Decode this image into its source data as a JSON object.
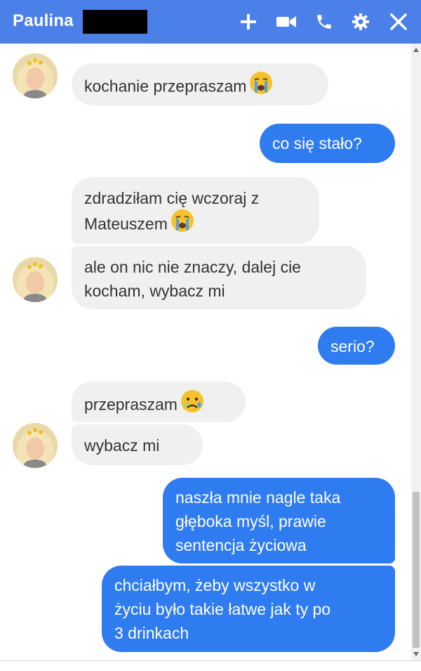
{
  "header": {
    "title": "Paulina",
    "redacted": true,
    "background_color": "#4a80e8",
    "icons": [
      "plus-icon",
      "video-camera-icon",
      "phone-icon",
      "gear-icon",
      "close-icon"
    ]
  },
  "messages": [
    {
      "from": "contact",
      "text": "kochanie przepraszam",
      "emoji": "crying-face"
    },
    {
      "from": "me",
      "text": "co się stało?"
    },
    {
      "from": "contact",
      "lines": [
        "zdradziłam cię wczoraj z",
        "Mateuszem"
      ],
      "emoji": "crying-face"
    },
    {
      "from": "contact",
      "lines": [
        "ale on nic nie znaczy, dalej cie",
        "kocham, wybacz mi"
      ]
    },
    {
      "from": "me",
      "text": "serio?"
    },
    {
      "from": "contact",
      "text": "przepraszam",
      "emoji": "sad-face"
    },
    {
      "from": "contact",
      "text": "wybacz mi"
    },
    {
      "from": "me",
      "lines": [
        "naszła mnie nagle taka",
        "głęboka myśl, prawie",
        "sentencja życiowa"
      ]
    },
    {
      "from": "me",
      "lines": [
        "chciałbym, żeby wszystko w",
        "życiu było takie łatwe jak ty po",
        "3 drinkach"
      ]
    }
  ],
  "colors": {
    "outgoing_bubble": "#2f7bf0",
    "incoming_bubble": "#f1f0f0",
    "incoming_text": "#333333"
  }
}
